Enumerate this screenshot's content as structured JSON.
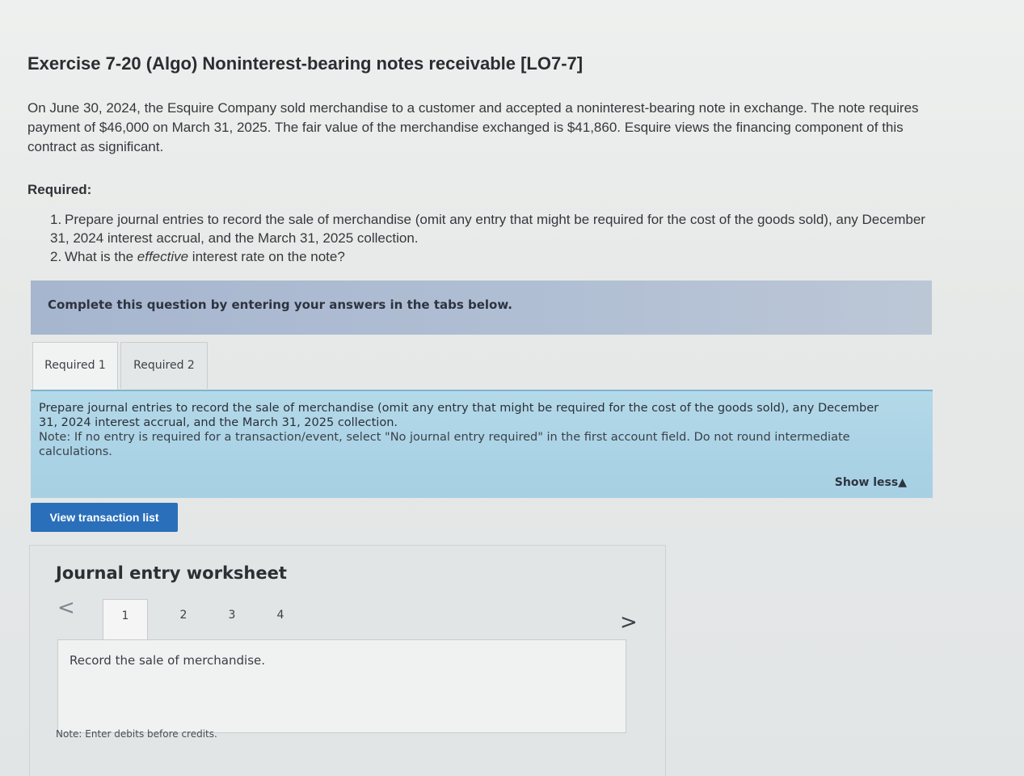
{
  "exercise": {
    "title": "Exercise 7-20 (Algo) Noninterest-bearing notes receivable [LO7-7]",
    "intro": "On June 30, 2024, the Esquire Company sold merchandise to a customer and accepted a noninterest-bearing note in exchange. The note requires payment of $46,000 on March 31, 2025. The fair value of the merchandise exchanged is $41,860. Esquire views the financing component of this contract as significant."
  },
  "required": {
    "label": "Required:",
    "items": [
      {
        "number": "1.",
        "text": "Prepare journal entries to record the sale of merchandise (omit any entry that might be required for the cost of the goods sold), any December 31, 2024 interest accrual, and the March 31, 2025 collection."
      },
      {
        "number": "2.",
        "text_before": "What is the ",
        "text_em": "effective",
        "text_after": " interest rate on the note?"
      }
    ]
  },
  "banner": {
    "text": "Complete this question by entering your answers in the tabs below."
  },
  "tabs": [
    {
      "label": "Required 1",
      "active": true
    },
    {
      "label": "Required 2",
      "active": false
    }
  ],
  "instructions": {
    "text": "Prepare journal entries to record the sale of merchandise (omit any entry that might be required for the cost of the goods sold), any December 31, 2024 interest accrual, and the March 31, 2025 collection.",
    "note": "Note: If no entry is required for a transaction/event, select \"No journal entry required\" in the first account field. Do not round intermediate calculations.",
    "show_less": "Show less"
  },
  "view_transaction_list": "View transaction list",
  "worksheet": {
    "title": "Journal entry worksheet",
    "steps": [
      "1",
      "2",
      "3",
      "4"
    ],
    "active_step": "1",
    "prompt": "Record the sale of merchandise.",
    "note": "Note: Enter debits before credits."
  }
}
